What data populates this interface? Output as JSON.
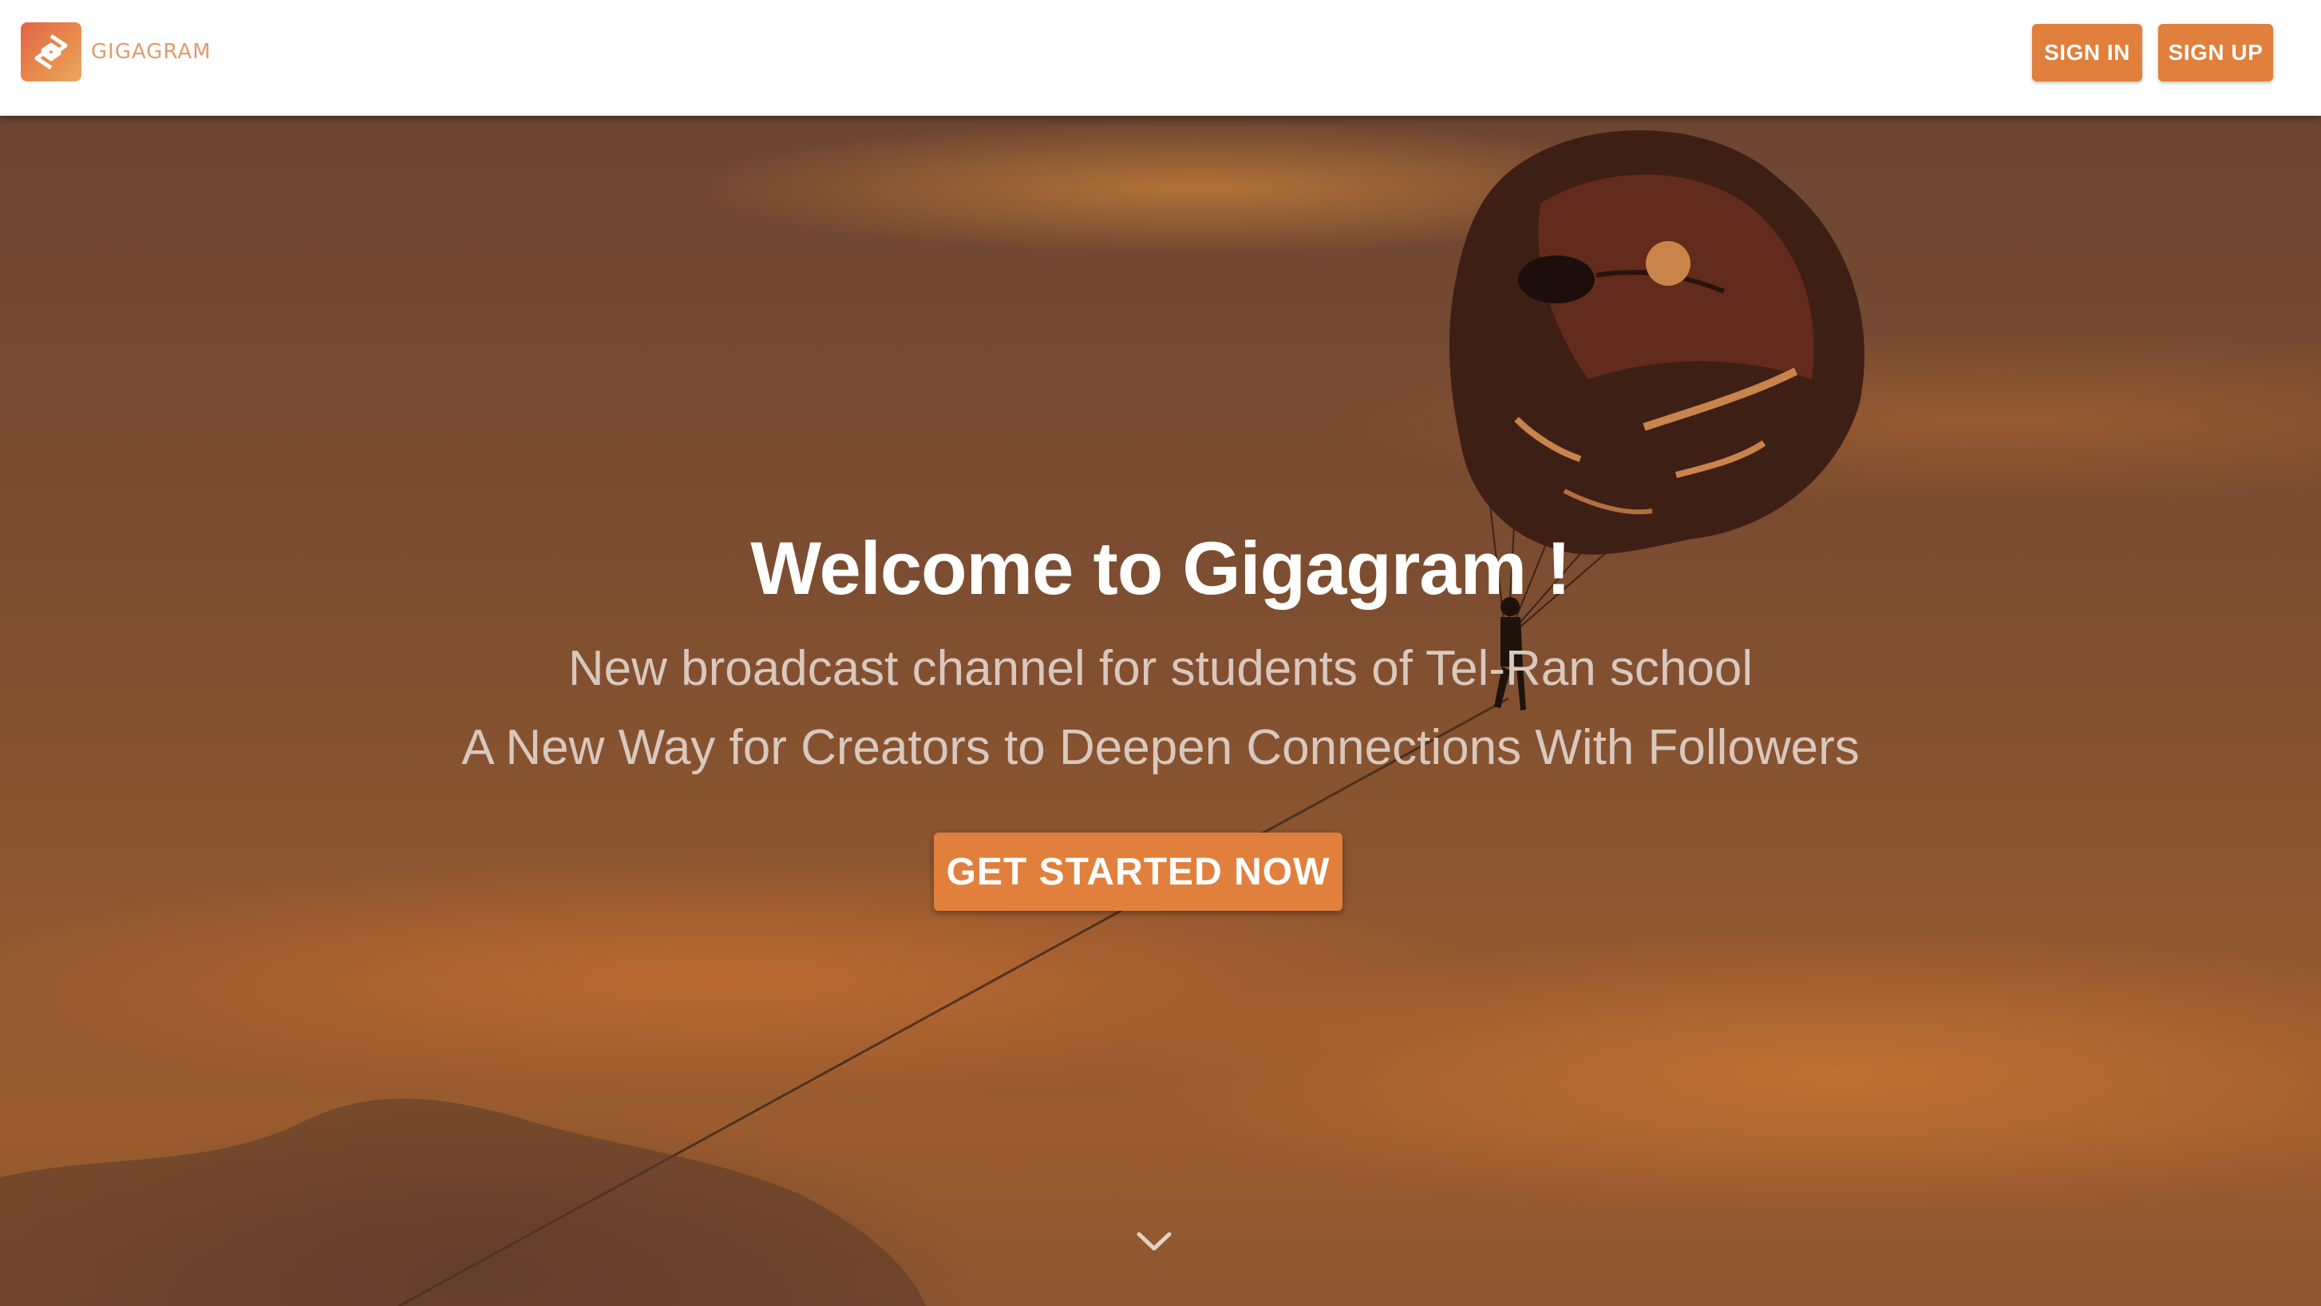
{
  "header": {
    "logo_text": "GIGAGRAM",
    "sign_in_label": "SIGN IN",
    "sign_up_label": "SIGN UP"
  },
  "hero": {
    "title": "Welcome to Gigagram !",
    "subtitle_1": "New broadcast channel for students of Tel-Ran school",
    "subtitle_2": "A New Way for Creators to Deepen Connections With Followers",
    "cta_label": "GET STARTED NOW",
    "background_icon": "parasail-sunset-image",
    "scroll_icon": "chevron-down-icon"
  },
  "colors": {
    "accent": "#e0803c",
    "header_bg": "#ffffff",
    "logo_text": "#e39a6a",
    "title": "#ffffff",
    "subtitle": "#d9c8bc"
  }
}
